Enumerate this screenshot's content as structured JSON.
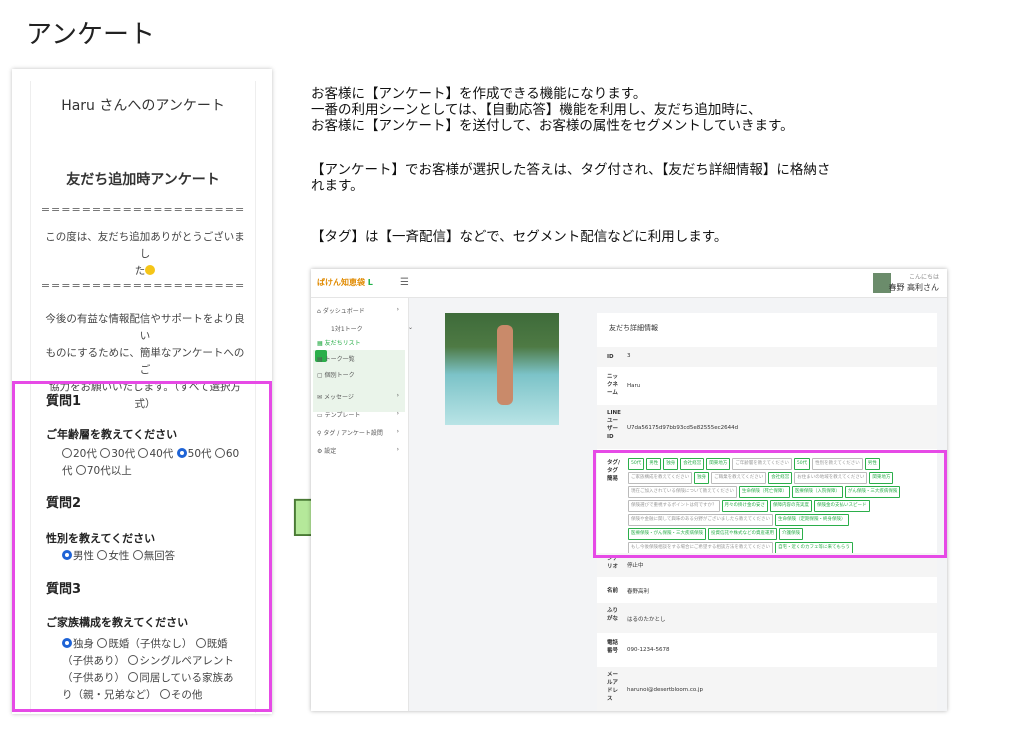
{
  "page_title": "アンケート",
  "survey": {
    "greeting": "Haru さんへのアンケート",
    "heading": "友だち追加時アンケート",
    "separator": "====================",
    "thanks_line1": "この度は、友だち追加ありがとうございまし",
    "thanks_line2": "た",
    "intro_line1": "今後の有益な情報配信やサポートをより良い",
    "intro_line2": "ものにするために、簡単なアンケートへのご",
    "intro_line3": "協力をお願いいたします。（すべて選択方",
    "intro_line4": "式）",
    "questions": [
      {
        "title": "質問1",
        "label": "ご年齢層を教えてください",
        "options": [
          "20代",
          "30代",
          "40代",
          "50代",
          "60代",
          "70代以上"
        ],
        "selected": 3
      },
      {
        "title": "質問2",
        "label": "性別を教えてください",
        "options": [
          "男性",
          "女性",
          "無回答"
        ],
        "selected": 0
      },
      {
        "title": "質問3",
        "label": "ご家族構成を教えてください",
        "options": [
          "独身",
          "既婚（子供なし）",
          "既婚（子供あり）",
          "シングルペアレント（子供あり）",
          "同居している家族あり（親・兄弟など）",
          "その他"
        ],
        "selected": 0
      }
    ]
  },
  "description": {
    "p1_line1": "お客様に【アンケート】を作成できる機能になります。",
    "p1_line2": "一番の利用シーンとしては、【自動応答】機能を利用し、友だち追加時に、",
    "p1_line3": "お客様に【アンケート】を送付して、お客様の属性をセグメントしていきます。",
    "p2_line1": "【アンケート】でお客様が選択した答えは、タグ付され、【友だち詳細情報】に格納さ",
    "p2_line2": "れます。",
    "p3": "【タグ】は【一斉配信】などで、セグメント配信などに利用します。"
  },
  "app": {
    "logo_text": "ぱけん知恵袋",
    "user_greeting": "こんにちは",
    "user_name": "春野 高利さん",
    "sidebar": [
      {
        "label": "ダッシュボード"
      },
      {
        "label": "1対1トーク"
      },
      {
        "label": "友だちリスト"
      },
      {
        "label": "トーク一覧"
      },
      {
        "label": "個別トーク"
      },
      {
        "label": "メッセージ"
      },
      {
        "label": "テンプレート"
      },
      {
        "label": "タグ / アンケート設問"
      },
      {
        "label": "設定"
      }
    ],
    "card_title": "友だち詳細情報",
    "rows": [
      {
        "k": "ID",
        "v": "3"
      },
      {
        "k": "ニックネーム",
        "v": "Haru"
      },
      {
        "k": "LINEユーザーID",
        "v": "U7da56175d97bb93cd5e82555ec2644d"
      },
      {
        "k": "タグ/タグ簡易",
        "v": ""
      },
      {
        "k": "シナリオ",
        "v": "停止中"
      },
      {
        "k": "名前",
        "v": "春野高利"
      },
      {
        "k": "ふりがな",
        "v": "はるのたかとし"
      },
      {
        "k": "電話番号",
        "v": "090-1234-5678"
      },
      {
        "k": "メールアドレス",
        "v": "harunoi@desertbloom.co.jp"
      }
    ],
    "tags": [
      {
        "t": "50代",
        "g": false
      },
      {
        "t": "男性",
        "g": false
      },
      {
        "t": "独身",
        "g": false
      },
      {
        "t": "会社経営",
        "g": false
      },
      {
        "t": "関東地方",
        "g": false
      },
      {
        "t": "ご年齢層を教えてください",
        "g": true
      },
      {
        "t": "50代",
        "g": false
      },
      {
        "t": "性別を教えてください",
        "g": true
      },
      {
        "t": "男性",
        "g": false
      },
      {
        "t": "ご家族構成を教えてください",
        "g": true
      },
      {
        "t": "独身",
        "g": false
      },
      {
        "t": "ご職業を教えてください",
        "g": true
      },
      {
        "t": "会社経営",
        "g": false
      },
      {
        "t": "お住まいの地域を教えてください",
        "g": true
      },
      {
        "t": "関東地方",
        "g": false
      },
      {
        "t": "現在ご加入されている保険について教えてください",
        "g": true
      },
      {
        "t": "生命保険（死亡保障）",
        "g": false
      },
      {
        "t": "医療保険（入院保障）",
        "g": false
      },
      {
        "t": "がん保険・三大疾病保険",
        "g": false
      },
      {
        "t": "保険選びで重視するポイントは何ですか？",
        "g": true
      },
      {
        "t": "月々の掛け金の安さ",
        "g": false
      },
      {
        "t": "保障内容の充実度",
        "g": false
      },
      {
        "t": "保険金の支払いスピード",
        "g": false
      },
      {
        "t": "保険や金融に関して興味のある分野がございましたら教えてください",
        "g": true
      },
      {
        "t": "生命保険（定期保険・終身保険）",
        "g": false
      },
      {
        "t": "医療保険・がん保険・三大疾病保険",
        "g": false
      },
      {
        "t": "投資信託や株式などの資産運用",
        "g": false
      },
      {
        "t": "介護保険",
        "g": false
      },
      {
        "t": "もし今後保険相談をする場合にご希望する相談方法を教えてください",
        "g": true
      },
      {
        "t": "自宅・近くのカフェ等に来てもらう",
        "g": false
      },
      {
        "t": "オンライン（ZOOMなど利用して）",
        "g": false
      }
    ]
  }
}
